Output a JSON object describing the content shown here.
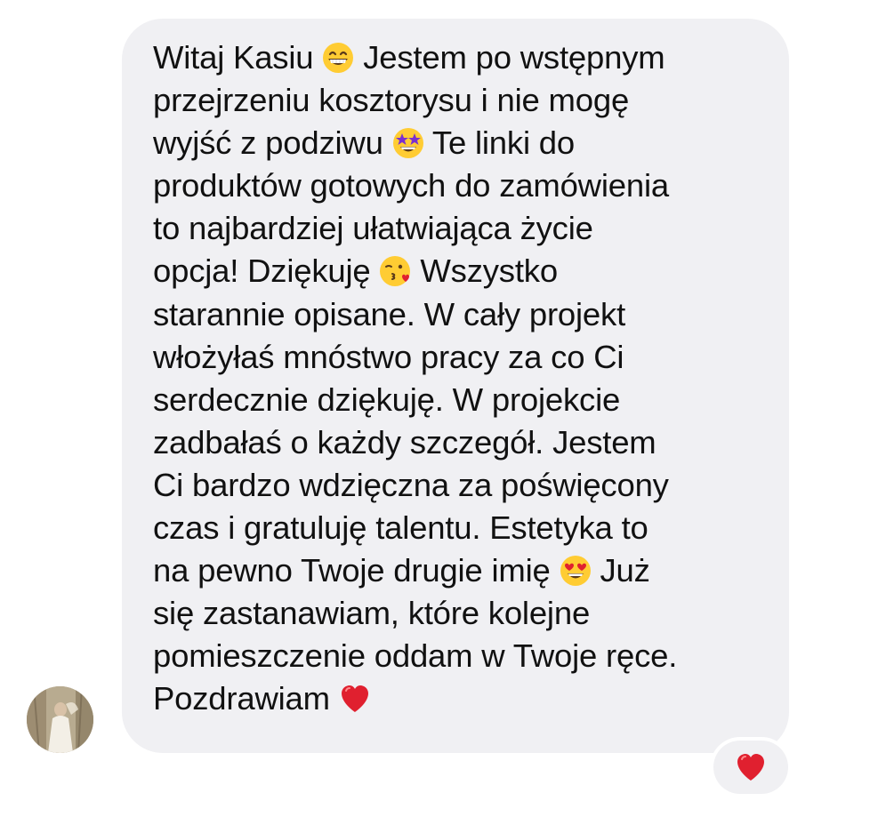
{
  "message": {
    "lines": [
      [
        "Witaj Kasiu ",
        {
          "emoji": "grinning-face-icon"
        },
        " Jestem po wstępnym"
      ],
      [
        "przejrzeniu kosztorysu i nie mogę"
      ],
      [
        "wyjść z podziwu ",
        {
          "emoji": "star-struck-face-icon"
        },
        " Te linki do"
      ],
      [
        "produktów gotowych do zamówienia"
      ],
      [
        "to najbardziej ułatwiająca życie"
      ],
      [
        "opcja! Dziękuję ",
        {
          "emoji": "face-blowing-kiss-icon"
        },
        " Wszystko"
      ],
      [
        "starannie opisane. W cały projekt"
      ],
      [
        "włożyłaś mnóstwo pracy za co Ci"
      ],
      [
        "serdecznie dziękuję. W projekcie"
      ],
      [
        "zadbałaś o każdy szczegół. Jestem"
      ],
      [
        "Ci bardzo wdzięczna za poświęcony"
      ],
      [
        "czas i gratuluję talentu. Estetyka to"
      ],
      [
        "na pewno Twoje drugie imię ",
        {
          "emoji": "heart-eyes-face-icon"
        },
        " Już"
      ],
      [
        "się zastanawiam, które kolejne"
      ],
      [
        "pomieszczenie oddam w Twoje ręce."
      ],
      [
        "Pozdrawiam ",
        {
          "emoji": "red-heart-icon"
        }
      ]
    ]
  },
  "reaction": {
    "emoji": "red-heart-icon"
  },
  "colors": {
    "bubble": "#f0f0f3",
    "text": "#111111",
    "heart": "#e0202f",
    "emoji_face": "#ffcc33"
  }
}
